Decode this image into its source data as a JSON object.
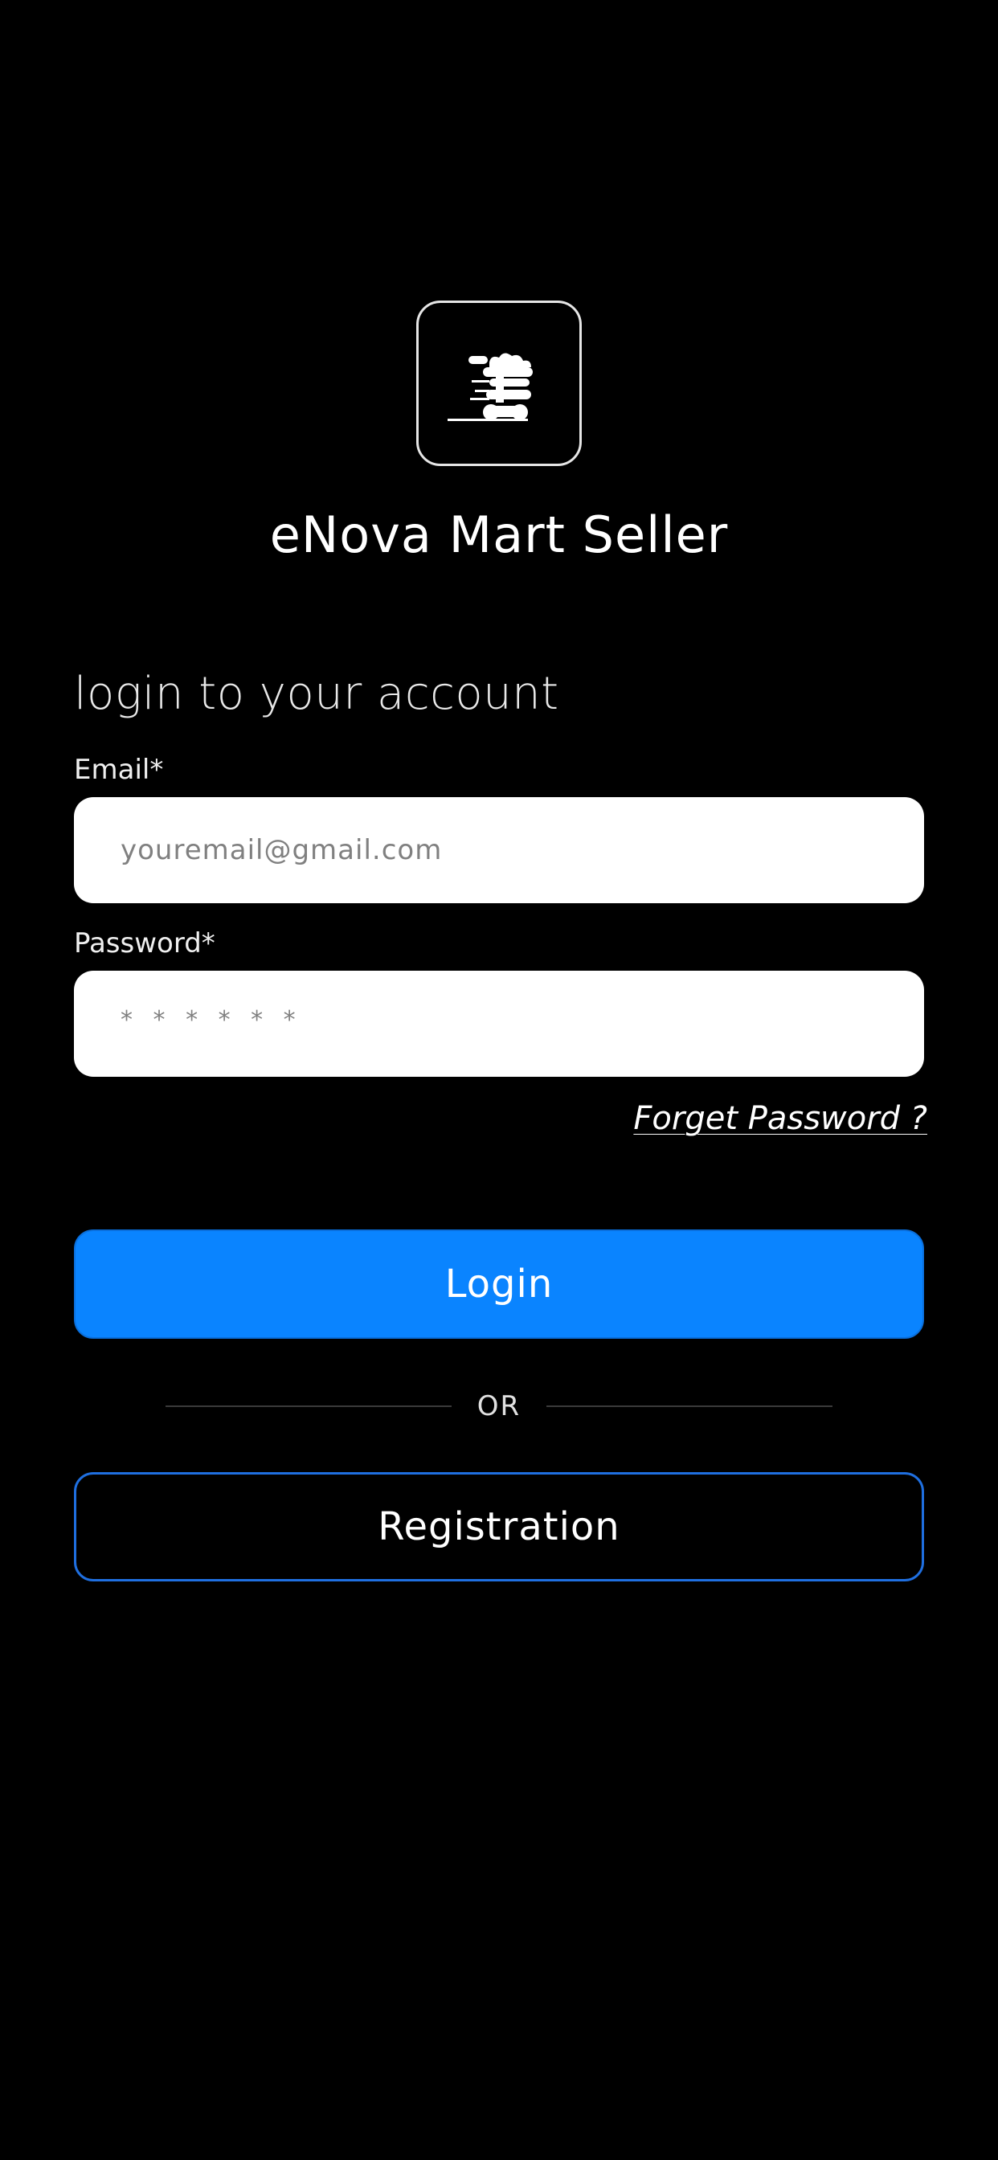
{
  "app": {
    "title": "eNova Mart Seller",
    "logo_icon": "fast-cart-icon"
  },
  "login": {
    "heading": "login to your account",
    "email_label": "Email*",
    "email_placeholder": "youremail@gmail.com",
    "password_label": "Password*",
    "password_placeholder": "* * * * * *",
    "forgot_password": "Forget Password ?",
    "login_button": "Login",
    "divider_text": "OR",
    "registration_button": "Registration"
  },
  "colors": {
    "background": "#000000",
    "primary": "#0a84ff",
    "registration_border": "#1f6fe0",
    "input_background": "#ffffff",
    "placeholder": "#808080"
  }
}
